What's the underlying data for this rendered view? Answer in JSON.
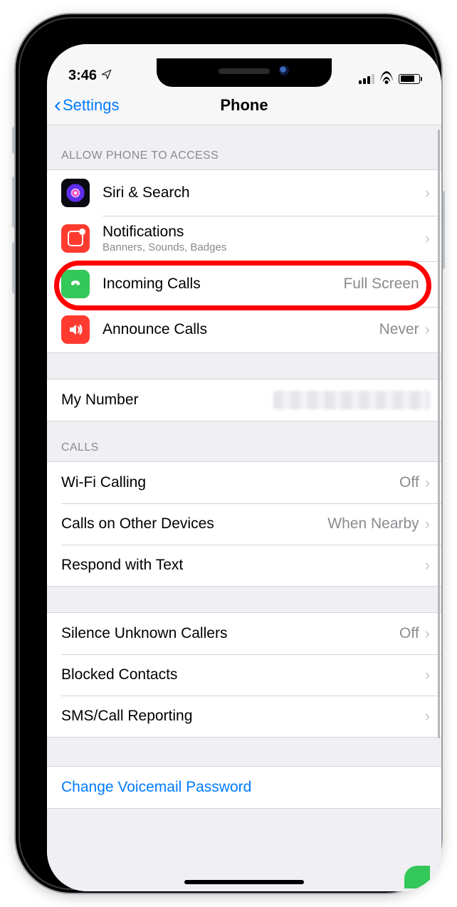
{
  "status": {
    "time": "3:46",
    "location_icon": "location-arrow"
  },
  "nav": {
    "back_label": "Settings",
    "title": "Phone"
  },
  "sections": {
    "access": {
      "header": "Allow Phone to Access",
      "items": [
        {
          "label": "Siri & Search"
        },
        {
          "label": "Notifications",
          "sublabel": "Banners, Sounds, Badges"
        },
        {
          "label": "Incoming Calls",
          "value": "Full Screen"
        },
        {
          "label": "Announce Calls",
          "value": "Never"
        }
      ]
    },
    "my_number": {
      "label": "My Number"
    },
    "calls": {
      "header": "Calls",
      "items": [
        {
          "label": "Wi-Fi Calling",
          "value": "Off"
        },
        {
          "label": "Calls on Other Devices",
          "value": "When Nearby"
        },
        {
          "label": "Respond with Text"
        }
      ]
    },
    "block": {
      "items": [
        {
          "label": "Silence Unknown Callers",
          "value": "Off"
        },
        {
          "label": "Blocked Contacts"
        },
        {
          "label": "SMS/Call Reporting"
        }
      ]
    },
    "voicemail": {
      "label": "Change Voicemail Password"
    }
  }
}
